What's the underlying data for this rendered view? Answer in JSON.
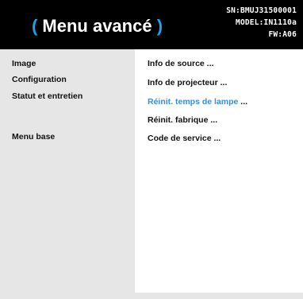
{
  "header": {
    "title_open": "(",
    "title_text": " Menu avancé ",
    "title_close": ")",
    "serial": "SN:BMUJ31500001",
    "model": "MODEL:IN1110a",
    "firmware": "FW:A06"
  },
  "left_menu": {
    "items": [
      {
        "label": "Image"
      },
      {
        "label": "Configuration"
      },
      {
        "label": "Statut et entretien"
      },
      {
        "label": "Menu base"
      }
    ]
  },
  "right_menu": {
    "items": [
      {
        "label": "Info de source",
        "dots": " ..."
      },
      {
        "label": "Info de projecteur",
        "dots": " ..."
      },
      {
        "label": "Réinit. temps de lampe",
        "dots": " ...",
        "selected": true
      },
      {
        "label": "Réinit. fabrique",
        "dots": " ..."
      },
      {
        "label": "Code de service",
        "dots": " ..."
      }
    ]
  },
  "colors": {
    "accent": "#1ea1e8",
    "selected_text": "#3a8ed6",
    "header_bg": "#000000",
    "panel_bg": "#e6e6e6"
  }
}
